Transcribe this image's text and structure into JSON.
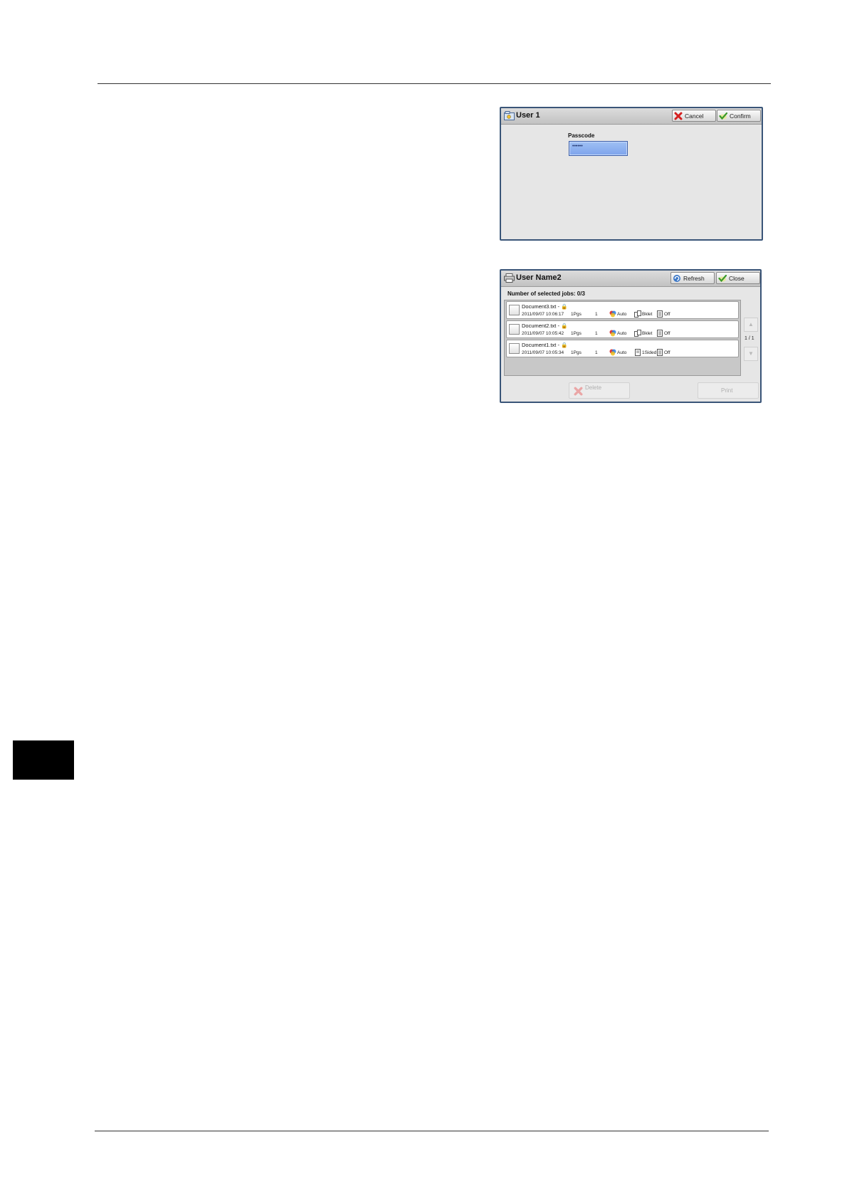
{
  "passcode_dialog": {
    "title": "User 1",
    "cancel_label": "Cancel",
    "confirm_label": "Confirm",
    "passcode_label": "Passcode",
    "passcode_value": "••••••"
  },
  "job_dialog": {
    "title": "User Name2",
    "refresh_label": "Refresh",
    "close_label": "Close",
    "selected_jobs": "Number of selected jobs: 0/3",
    "jobs": [
      {
        "name": "Document3.txt - ",
        "datetime": "2011/09/07 10:06:17",
        "pages": "1Pgs",
        "copies": "1",
        "color": "Auto",
        "sides": "Bklet",
        "staple": "Off"
      },
      {
        "name": "Document2.txt - ",
        "datetime": "2011/09/07 10:05:42",
        "pages": "1Pgs",
        "copies": "1",
        "color": "Auto",
        "sides": "Bklet",
        "staple": "Off"
      },
      {
        "name": "Document1.txt - ",
        "datetime": "2011/09/07 10:05:34",
        "pages": "1Pgs",
        "copies": "1",
        "color": "Auto",
        "sides": "1Sided",
        "staple": "Off"
      }
    ],
    "page_indicator": "1 / 1",
    "delete_label": "Delete",
    "print_label": "Print"
  }
}
